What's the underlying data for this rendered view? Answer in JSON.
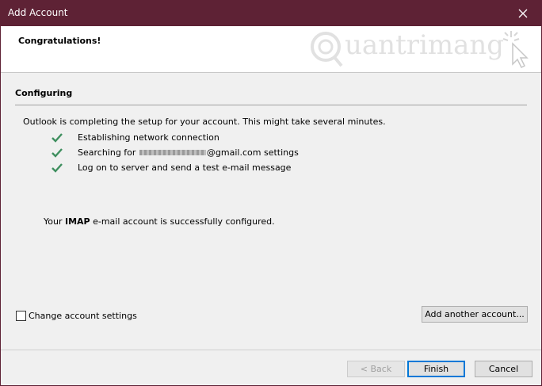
{
  "window": {
    "title": "Add Account"
  },
  "header": {
    "title": "Congratulations!",
    "watermark": "uantrimang"
  },
  "section": {
    "title": "Configuring",
    "intro": "Outlook is completing the setup for your account. This might take several minutes.",
    "steps": [
      {
        "label": "Establishing network connection",
        "status": "done"
      },
      {
        "label_prefix": "Searching for ",
        "label_suffix": "@gmail.com settings",
        "status": "done"
      },
      {
        "label": "Log on to server and send a test e-mail message",
        "status": "done"
      }
    ],
    "result_prefix": "Your ",
    "result_bold": "IMAP",
    "result_suffix": " e-mail account is successfully configured."
  },
  "options": {
    "change_settings_label": "Change account settings",
    "change_settings_checked": false,
    "add_another_label": "Add another account..."
  },
  "footer": {
    "back_label": "< Back",
    "finish_label": "Finish",
    "cancel_label": "Cancel"
  },
  "colors": {
    "titlebar": "#5e2235",
    "check": "#3f8f5f",
    "default_button_border": "#0078d7"
  }
}
